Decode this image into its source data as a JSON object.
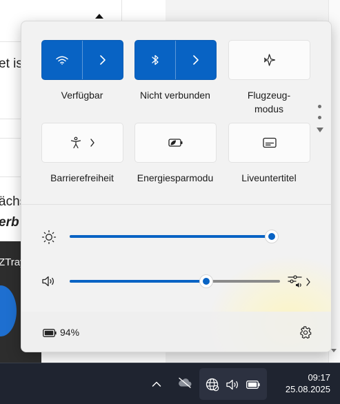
{
  "background": {
    "text_lines": [
      "et ist",
      "ächs",
      "erb"
    ],
    "dark_window_title": "ZTray"
  },
  "quick_settings": {
    "tiles": [
      {
        "id": "wifi",
        "label": "Verfügbar",
        "icon": "wifi-icon",
        "active": true,
        "has_chevron": true
      },
      {
        "id": "bluetooth",
        "label": "Nicht verbunden",
        "icon": "bluetooth-icon",
        "active": true,
        "has_chevron": true
      },
      {
        "id": "airplane",
        "label": "Flugzeug-\nmodus",
        "label_line1": "Flugzeug-",
        "label_line2": "modus",
        "icon": "airplane-icon",
        "active": false
      },
      {
        "id": "accessibility",
        "label": "Barrierefreiheit",
        "icon": "accessibility-icon",
        "active": false,
        "has_chevron": true
      },
      {
        "id": "energy_saver",
        "label": "Energiesparmodu",
        "icon": "energy-saver-icon",
        "active": false
      },
      {
        "id": "live_captions",
        "label": "Liveuntertitel",
        "icon": "live-captions-icon",
        "active": false
      }
    ],
    "brightness": {
      "icon": "sun-icon",
      "value_percent": 100
    },
    "volume": {
      "icon": "speaker-icon",
      "value_percent": 65,
      "mixer_icon": "sound-mixer-icon"
    },
    "battery": {
      "icon": "battery-icon",
      "percent_text": "94%"
    },
    "settings_icon": "gear-icon"
  },
  "taskbar": {
    "tray_icons": [
      "chevron-up-icon",
      "cloud-offline-icon",
      "network-icon",
      "volume-icon",
      "battery-icon"
    ],
    "time": "09:17",
    "date": "25.08.2025"
  },
  "colors": {
    "accent": "#0863c4",
    "panel_bg": "#f2f2f2",
    "taskbar_bg": "#1f2430"
  }
}
